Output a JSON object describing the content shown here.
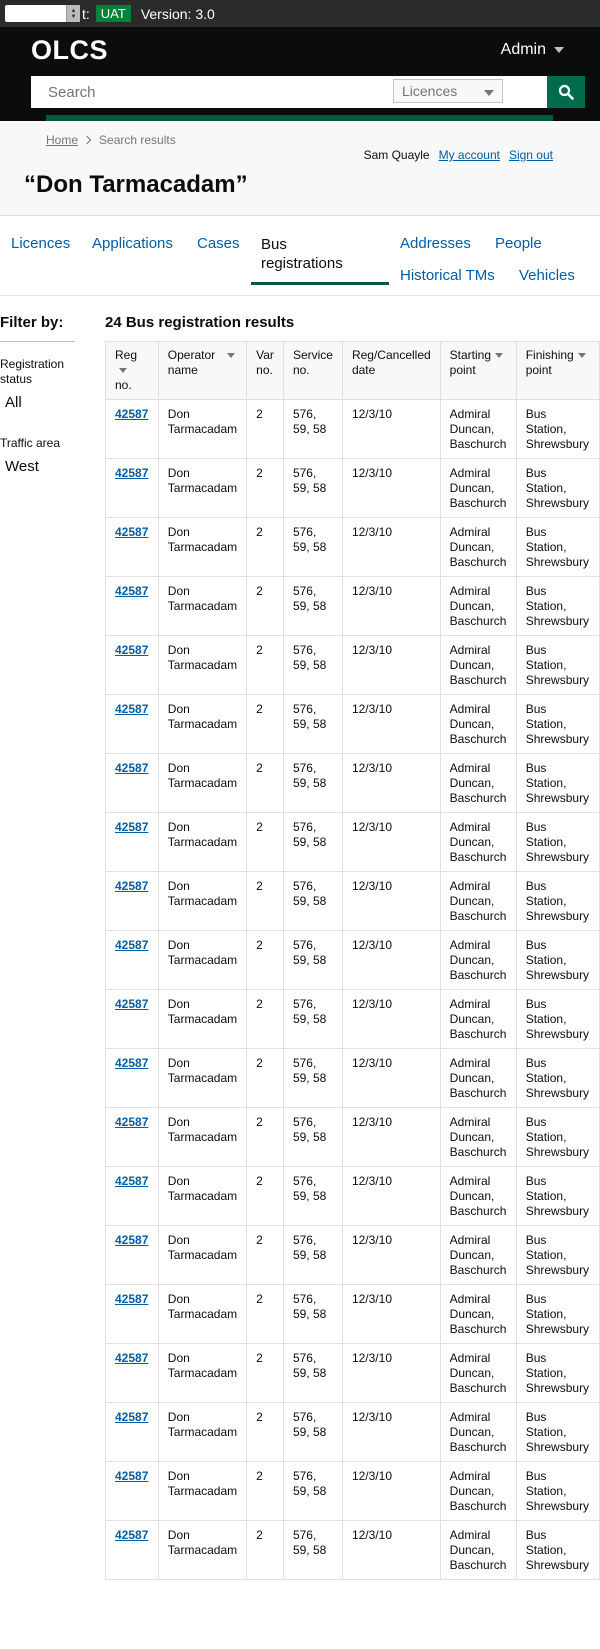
{
  "env": {
    "label": "t:",
    "badge": "UAT",
    "version_label": "Version:",
    "version": "3.0"
  },
  "header": {
    "logo": "OLCS",
    "admin_label": "Admin",
    "search_placeholder": "Search",
    "search_type": "Licences"
  },
  "breadcrumb": {
    "home": "Home",
    "current": "Search results"
  },
  "user": {
    "name": "Sam Quayle",
    "account": "My account",
    "signout": "Sign out"
  },
  "page_title": "“Don Tarmacadam”",
  "tabs": {
    "licences": "Licences",
    "applications": "Applications",
    "cases": "Cases",
    "bus_line1": "Bus",
    "bus_line2": "registrations",
    "addresses": "Addresses",
    "people": "People",
    "historical": "Historical TMs",
    "vehicles": "Vehicles"
  },
  "filter": {
    "title": "Filter by:",
    "reg_status_line1": "Registration",
    "reg_status_line2": "status",
    "reg_status_value": "All",
    "traffic_area": "Traffic area",
    "traffic_area_value": "West"
  },
  "results": {
    "title": "24 Bus registration results",
    "headers": {
      "reg1": "Reg",
      "reg2": "no.",
      "op1": "Operator",
      "op2": "name",
      "var1": "Var",
      "var2": "no.",
      "svc1": "Service",
      "svc2": "no.",
      "date1": "Reg/Cancelled",
      "date2": "date",
      "start1": "Starting",
      "start2": "point",
      "finish1": "Finishing",
      "finish2": "point"
    },
    "row": {
      "reg": "42587",
      "op1": "Don",
      "op2": "Tarmacadam",
      "var": "2",
      "svc1": "576,",
      "svc2": "59, 58",
      "date": "12/3/10",
      "start1": "Admiral",
      "start2": "Duncan,",
      "start3": "Baschurch",
      "finish1": "Bus",
      "finish2": "Station,",
      "finish3": "Shrewsbury"
    }
  }
}
